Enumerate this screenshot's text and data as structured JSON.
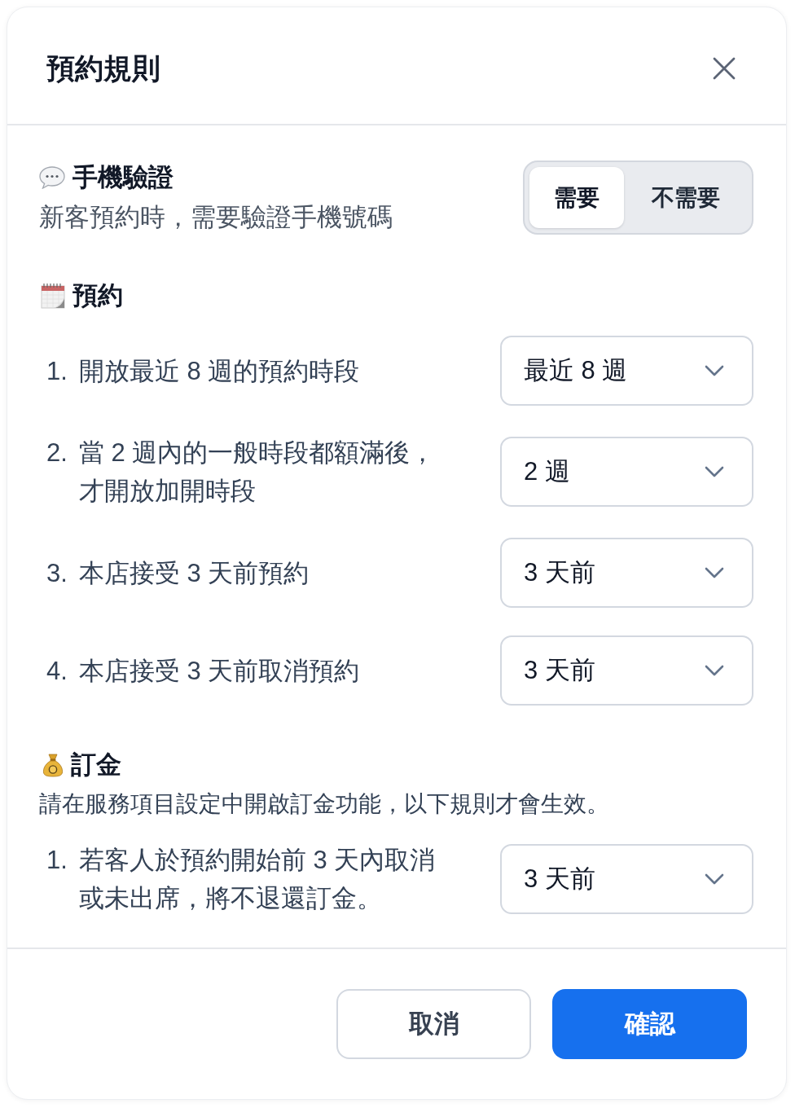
{
  "dialog": {
    "title": "預約規則"
  },
  "phone_verification": {
    "title": "手機驗證",
    "description": "新客預約時，需要驗證手機號碼",
    "options": [
      {
        "label": "需要",
        "selected": true
      },
      {
        "label": "不需要",
        "selected": false
      }
    ]
  },
  "booking": {
    "title": "預約",
    "rules": [
      {
        "number": "1.",
        "text": "開放最近 8 週的預約時段",
        "value": "最近 8 週"
      },
      {
        "number": "2.",
        "text": "當 2 週內的一般時段都額滿後，才開放加開時段",
        "value": "2 週"
      },
      {
        "number": "3.",
        "text": "本店接受 3 天前預約",
        "value": "3 天前"
      },
      {
        "number": "4.",
        "text": "本店接受 3 天前取消預約",
        "value": "3 天前"
      }
    ]
  },
  "deposit": {
    "title": "訂金",
    "description": "請在服務項目設定中開啟訂金功能，以下規則才會生效。",
    "rules": [
      {
        "number": "1.",
        "text": "若客人於預約開始前 3 天內取消或未出席，將不退還訂金。",
        "value": "3 天前"
      }
    ]
  },
  "footer": {
    "buttons": [
      {
        "label": "取消",
        "kind": "secondary"
      },
      {
        "label": "確認",
        "kind": "primary"
      }
    ]
  }
}
